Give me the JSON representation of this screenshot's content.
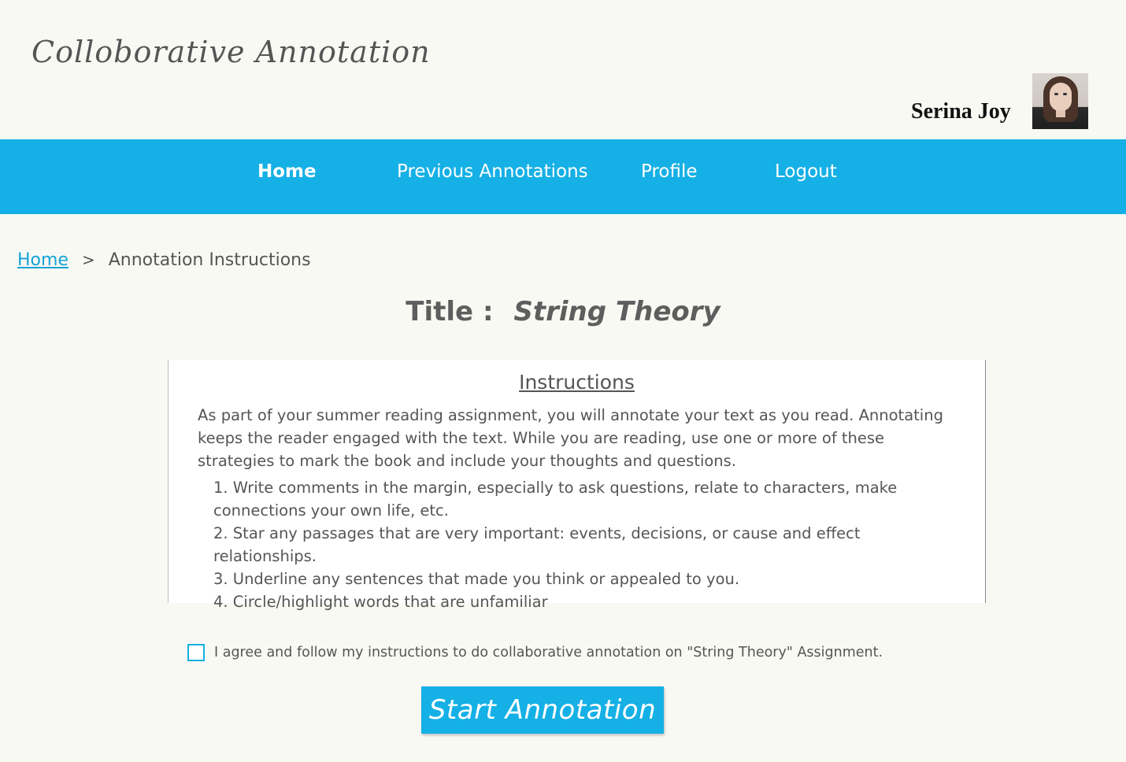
{
  "app": {
    "title": "Colloborative Annotation"
  },
  "user": {
    "name": "Serina Joy",
    "avatar_icon": "user-photo"
  },
  "nav": {
    "items": [
      {
        "label": "Home",
        "active": true
      },
      {
        "label": "Previous Annotations",
        "active": false
      },
      {
        "label": "Profile",
        "active": false
      },
      {
        "label": "Logout",
        "active": false
      }
    ]
  },
  "breadcrumb": {
    "home": "Home",
    "separator": ">",
    "current": "Annotation Instructions"
  },
  "document": {
    "title_label": "Title :",
    "title_value": "String Theory"
  },
  "instructions": {
    "heading": "Instructions",
    "intro": "As part of your summer reading assignment, you will annotate your text as you read. Annotating keeps the reader engaged with the text. While you are reading, use one or more of these  strategies to mark the book and include your thoughts and questions.",
    "items": [
      "1. Write comments in the margin, especially to ask questions, relate to characters, make connections your own life, etc.",
      "2. Star any passages that are very important: events, decisions, or cause and effect relationships.",
      "3. Underline any sentences that made you think or appealed to you.",
      "4. Circle/highlight words that are unfamiliar"
    ]
  },
  "agreement": {
    "checked": false,
    "label": "I agree and follow my instructions to do collaborative annotation on \"String Theory\" Assignment."
  },
  "actions": {
    "start_label": "Start Annotation"
  },
  "colors": {
    "accent": "#15b0e5",
    "background": "#f9f9f4",
    "text": "#555555"
  }
}
